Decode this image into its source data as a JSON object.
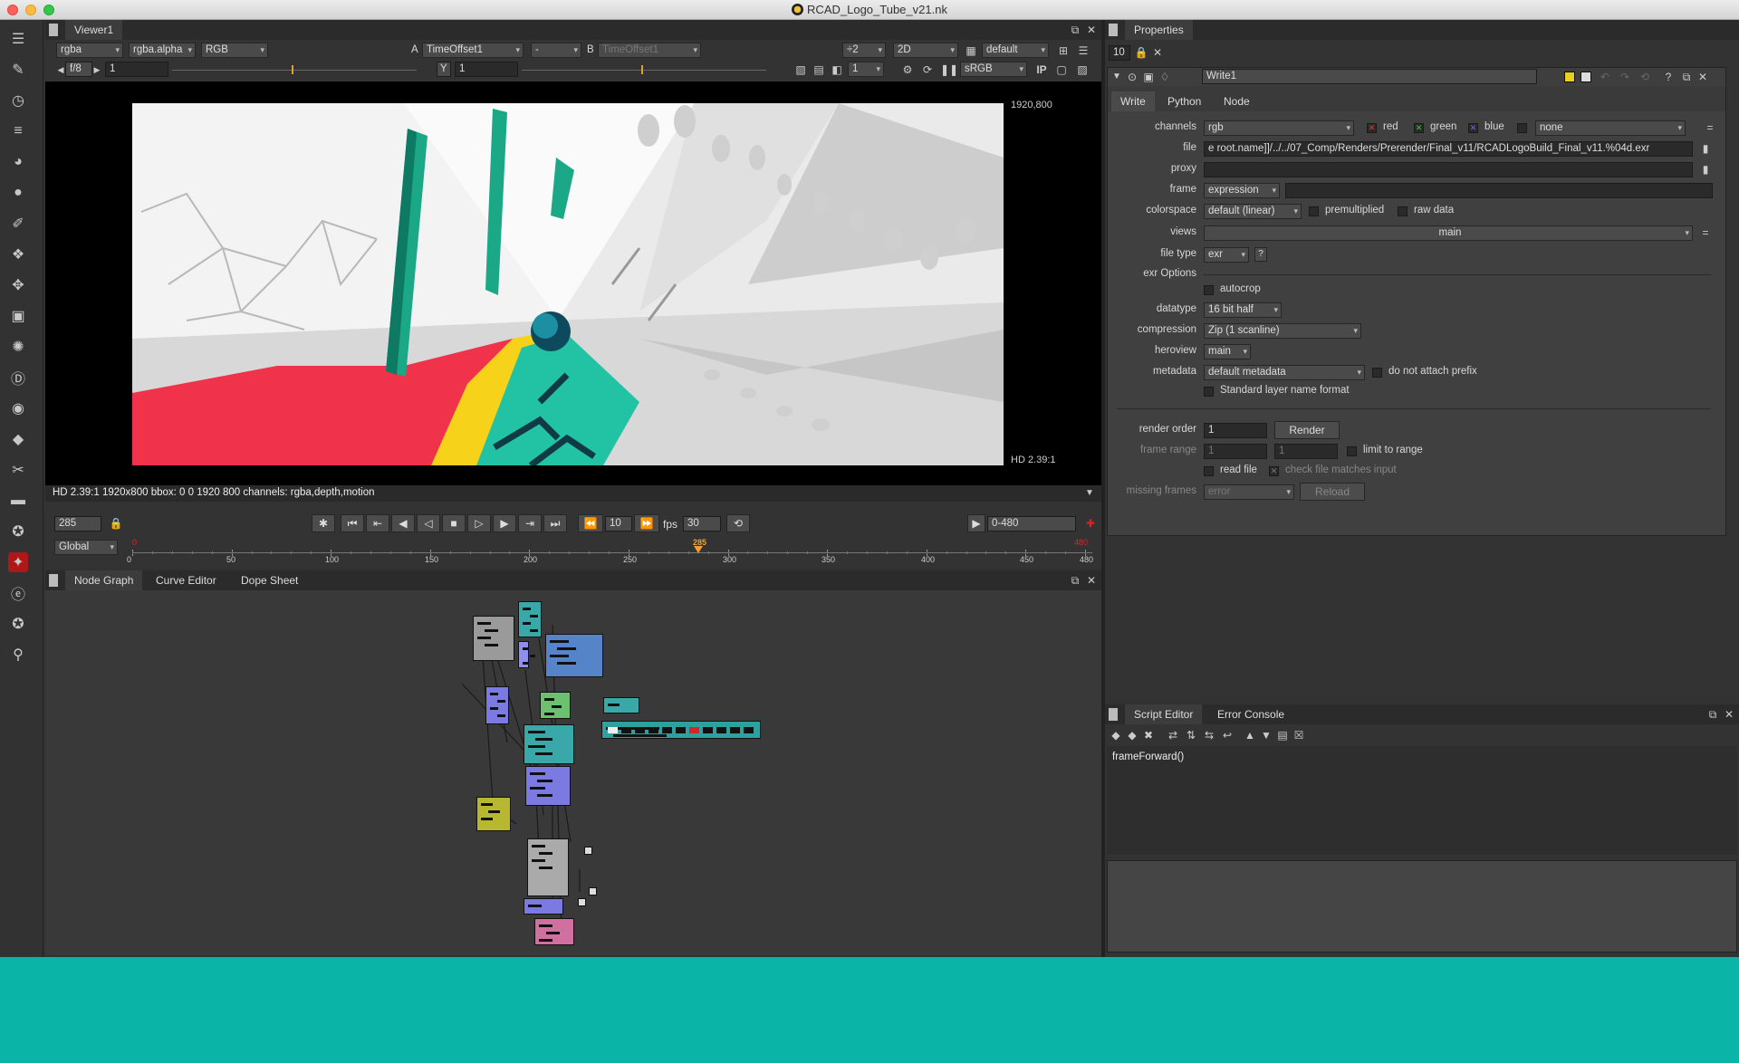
{
  "window": {
    "title": "RCAD_Logo_Tube_v21.nk"
  },
  "viewer": {
    "tab": "Viewer1",
    "channels": "rgba",
    "alpha_channel": "rgba.alpha",
    "display_channel": "RGB",
    "input_a_label": "A",
    "input_a": "TimeOffset1",
    "compare_op": "-",
    "input_b_label": "B",
    "input_b": "TimeOffset1",
    "downscale": "÷2",
    "view_mode": "2D",
    "lut_profile": "default",
    "fstop": "f/8",
    "gain": "1",
    "y_label": "Y",
    "gamma": "1",
    "zoom_value": "1",
    "colorspace": "sRGB",
    "ip_label": "IP",
    "resolution_label": "1920,800",
    "format_label": "HD 2.39:1",
    "info_bar": "HD 2.39:1 1920x800 bbox: 0 0 1920 800 channels: rgba,depth,motion"
  },
  "timeline": {
    "current_frame": "285",
    "play_increment": "10",
    "fps_label": "fps",
    "fps": "30",
    "range": "0-480",
    "range_mode": "Global",
    "ticks": [
      "0",
      "50",
      "100",
      "150",
      "200",
      "250",
      "300",
      "350",
      "400",
      "450",
      "480"
    ],
    "start_marker": "0",
    "playhead_marker": "285",
    "end_marker": "480",
    "playhead_fraction": 0.594
  },
  "node_graph": {
    "tabs": [
      "Node Graph",
      "Curve Editor",
      "Dope Sheet"
    ]
  },
  "properties": {
    "title": "Properties",
    "max_panels": "10",
    "node_name": "Write1",
    "tabs": [
      "Write",
      "Python",
      "Node"
    ],
    "labels": {
      "channels": "channels",
      "file": "file",
      "proxy": "proxy",
      "frame": "frame",
      "colorspace": "colorspace",
      "views": "views",
      "file_type": "file type",
      "exr_options": "exr Options",
      "datatype": "datatype",
      "compression": "compression",
      "heroview": "heroview",
      "metadata": "metadata",
      "render_order": "render order",
      "frame_range": "frame range",
      "missing_frames": "missing frames"
    },
    "channels": "rgb",
    "chan_red": "red",
    "chan_green": "green",
    "chan_blue": "blue",
    "chan_extra": "none",
    "file": "e root.name]]/../../07_Comp/Renders/Prerender/Final_v11/RCADLogoBuild_Final_v11.%04d.exr",
    "proxy": "",
    "frame": "expression",
    "frame_expr": "",
    "colorspace": "default (linear)",
    "premultiplied": "premultiplied",
    "raw_data": "raw data",
    "views": "main",
    "file_type": "exr",
    "help": "?",
    "autocrop": "autocrop",
    "datatype": "16 bit half",
    "compression": "Zip (1 scanline)",
    "heroview": "main",
    "metadata": "default metadata",
    "do_not_attach_prefix": "do not attach prefix",
    "standard_layer_name": "Standard layer name format",
    "render_order": "1",
    "render_button": "Render",
    "frame_range_start": "1",
    "frame_range_end": "1",
    "limit_to_range": "limit to range",
    "read_file": "read file",
    "check_file_matches": "check file matches input",
    "missing_frames": "error",
    "reload_button": "Reload"
  },
  "script_editor": {
    "tabs": [
      "Script Editor",
      "Error Console"
    ],
    "code": "frameForward()"
  },
  "colors": {
    "accent_teal": "#0ab5a8",
    "panel_bg": "#393939",
    "frame_marker": "#f0a030"
  }
}
